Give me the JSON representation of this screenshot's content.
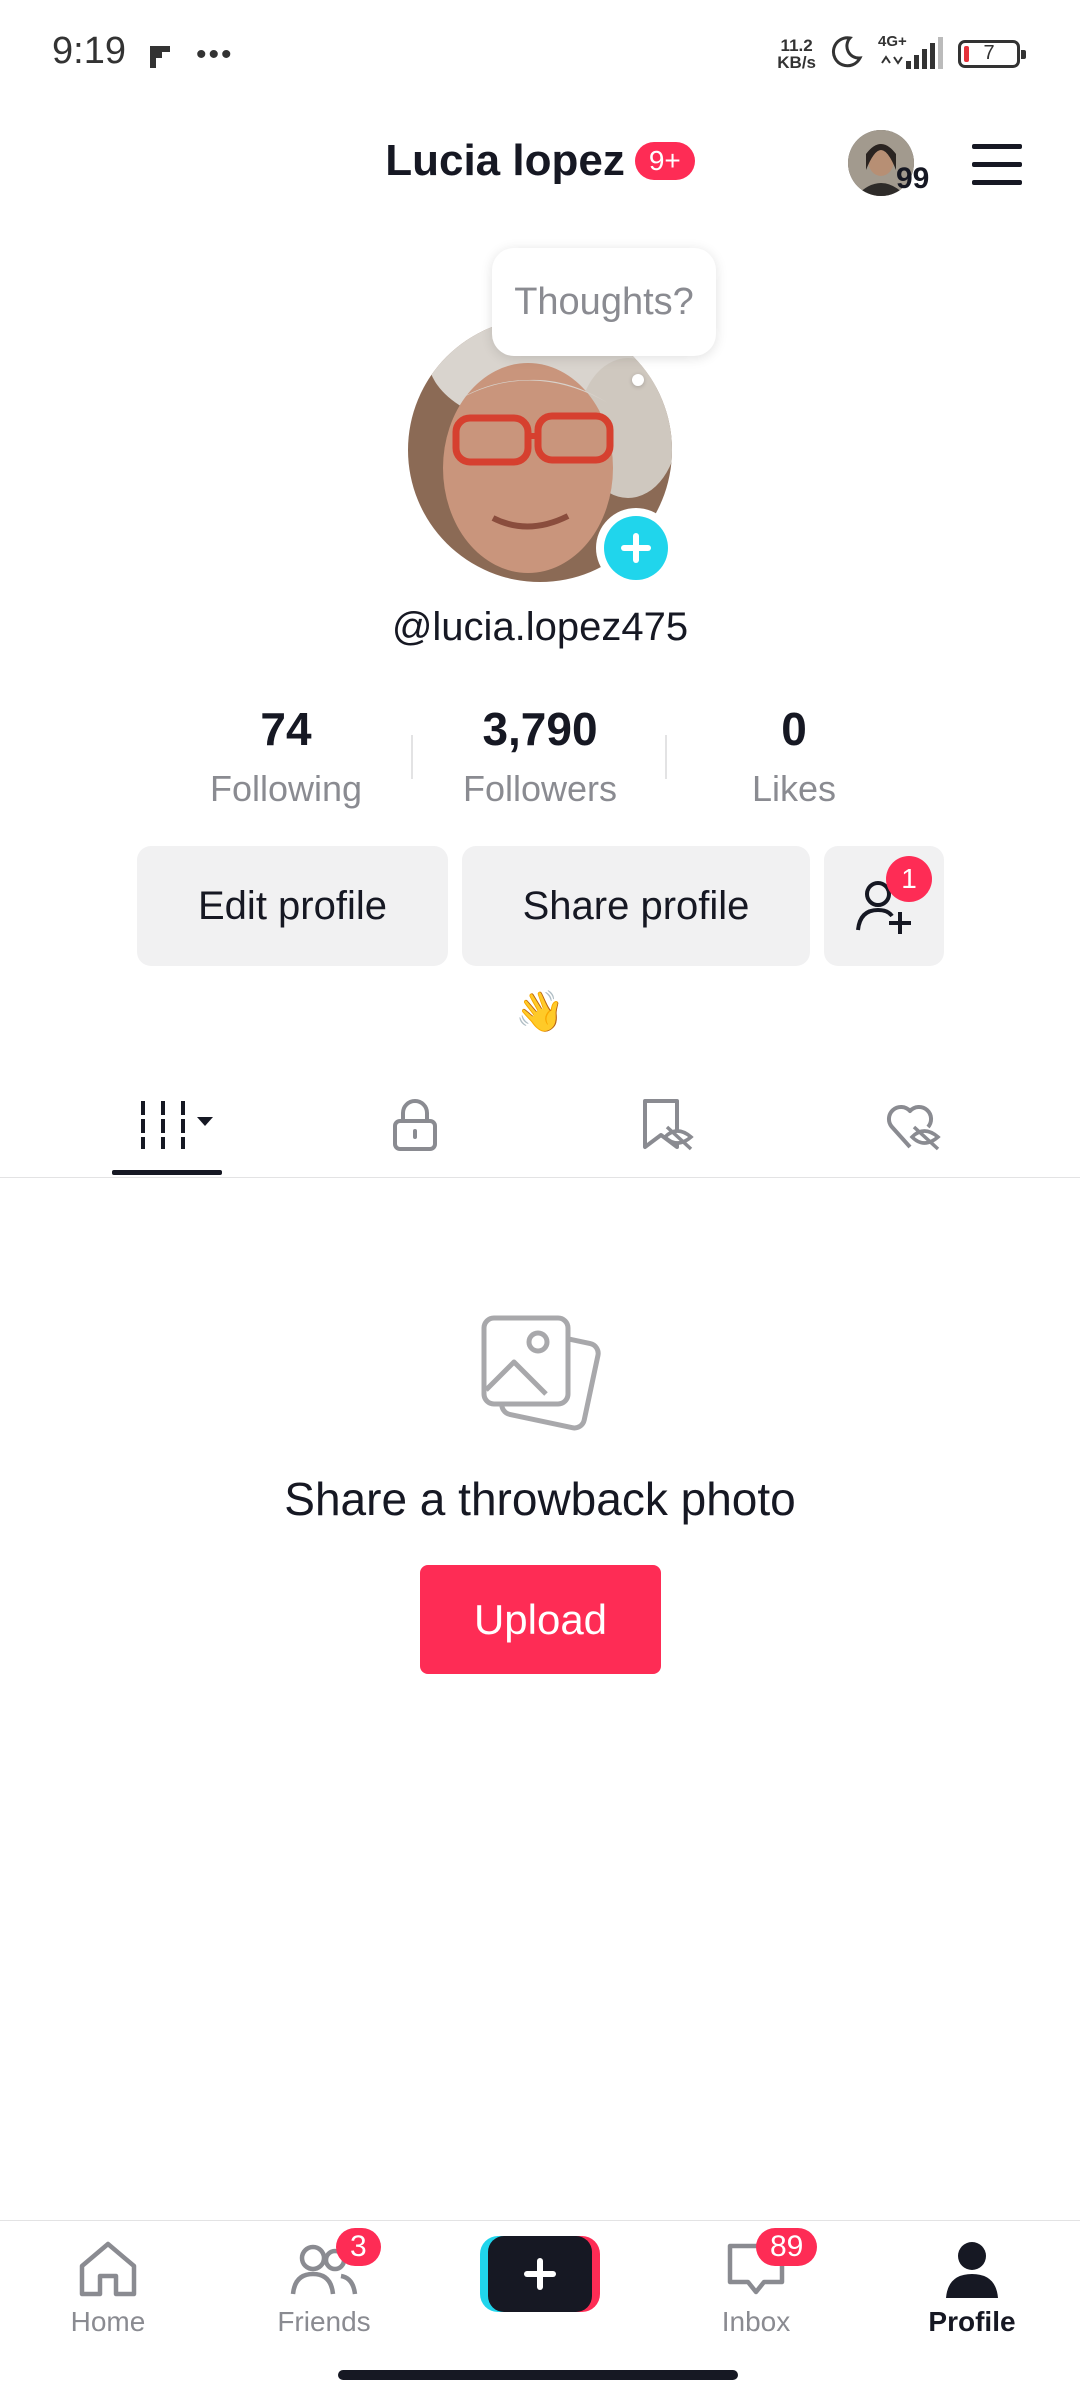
{
  "status_bar": {
    "time": "9:19",
    "net_speed_value": "11.2",
    "net_speed_unit": "KB/s",
    "network": "4G+",
    "battery": "7"
  },
  "header": {
    "name": "Lucia lopez",
    "notification_badge": "9+",
    "friends_count": "99"
  },
  "profile": {
    "thought_prompt": "Thoughts?",
    "handle": "@lucia.lopez475",
    "bio_emoji": "👋",
    "stats": [
      {
        "value": "74",
        "label": "Following"
      },
      {
        "value": "3,790",
        "label": "Followers"
      },
      {
        "value": "0",
        "label": "Likes"
      }
    ],
    "buttons": {
      "edit": "Edit profile",
      "share": "Share profile",
      "add_friends_badge": "1"
    }
  },
  "empty_state": {
    "title": "Share a throwback photo",
    "button": "Upload"
  },
  "bottom_nav": {
    "home": "Home",
    "friends": "Friends",
    "friends_badge": "3",
    "inbox": "Inbox",
    "inbox_badge": "89",
    "profile": "Profile"
  },
  "colors": {
    "accent": "#fe2c55",
    "cyan": "#20d5ec",
    "text": "#161823",
    "muted": "#8a8b91"
  }
}
